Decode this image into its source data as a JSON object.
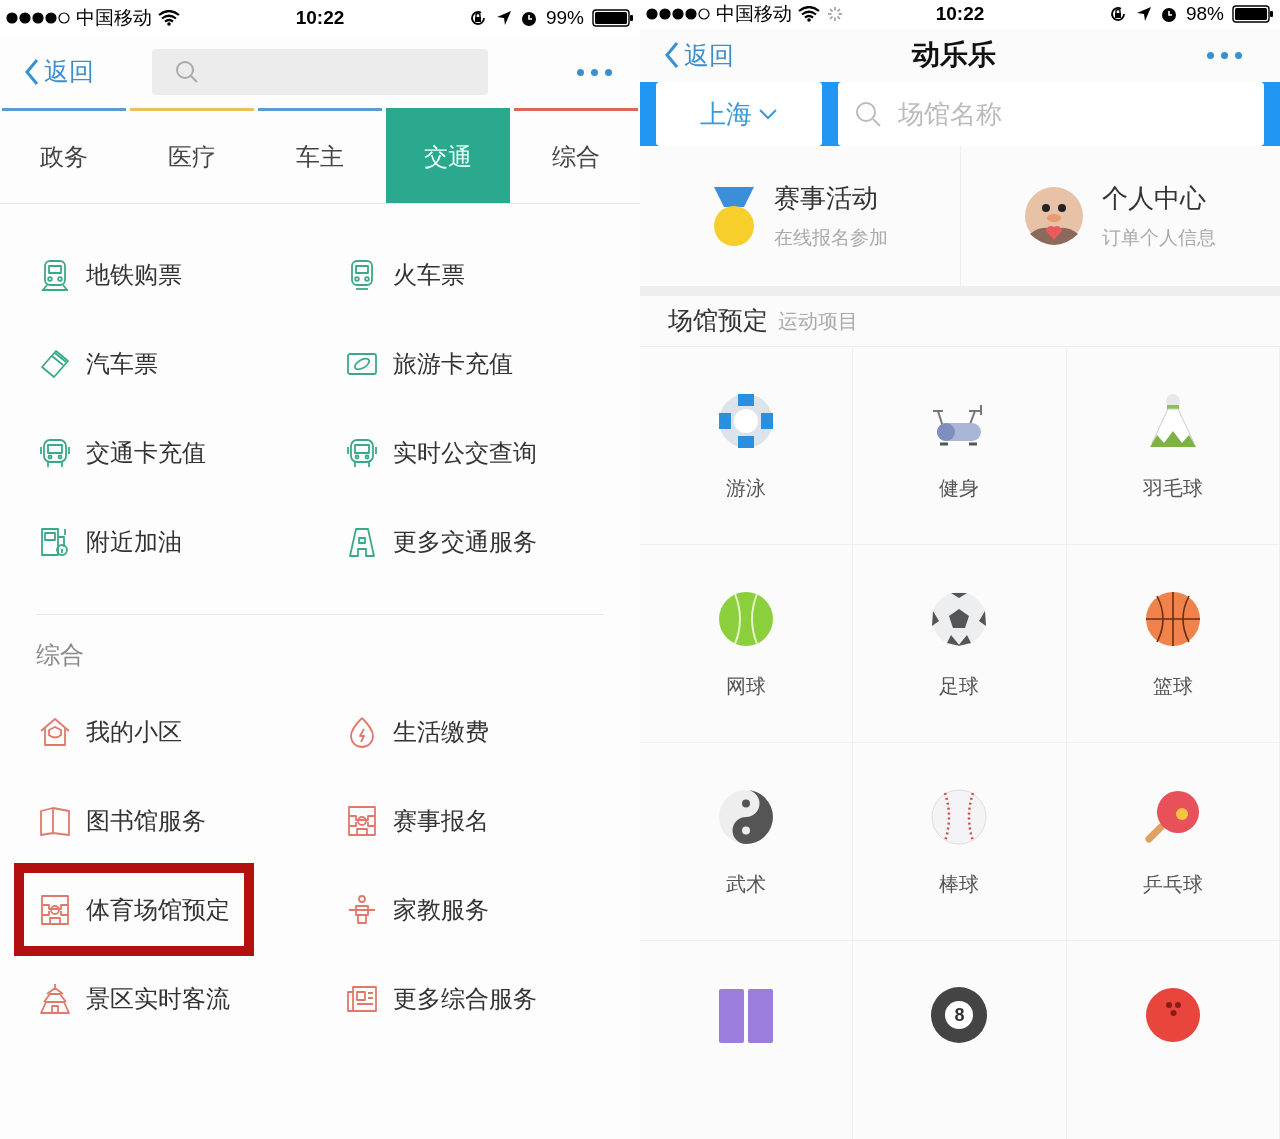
{
  "left": {
    "status_bar": {
      "carrier": "中国移动",
      "time": "10:22",
      "battery": "99%",
      "loading": false
    },
    "nav": {
      "back": "返回"
    },
    "tabs": [
      {
        "label": "政务",
        "selected": false,
        "color": "#5b9bd5"
      },
      {
        "label": "医疗",
        "selected": false,
        "color": "#e8c15e"
      },
      {
        "label": "车主",
        "selected": false,
        "color": "#5b9bd5"
      },
      {
        "label": "交通",
        "selected": true,
        "color": "#2aa98e"
      },
      {
        "label": "综合",
        "selected": false,
        "color": "#d9675c"
      }
    ],
    "sections": [
      {
        "color": "#3aa98a",
        "items": [
          {
            "label": "地铁购票",
            "highlighted": false
          },
          {
            "label": "火车票",
            "highlighted": false
          },
          {
            "label": "汽车票",
            "highlighted": false
          },
          {
            "label": "旅游卡充值",
            "highlighted": false
          },
          {
            "label": "交通卡充值",
            "highlighted": false
          },
          {
            "label": "实时公交查询",
            "highlighted": false
          },
          {
            "label": "附近加油",
            "highlighted": false
          },
          {
            "label": "更多交通服务",
            "highlighted": false
          }
        ]
      },
      {
        "title": "综合",
        "color": "#e0796c",
        "items": [
          {
            "label": "我的小区",
            "highlighted": false
          },
          {
            "label": "生活缴费",
            "highlighted": false
          },
          {
            "label": "图书馆服务",
            "highlighted": false
          },
          {
            "label": "赛事报名",
            "highlighted": false
          },
          {
            "label": "体育场馆预定",
            "highlighted": true
          },
          {
            "label": "家教服务",
            "highlighted": false
          },
          {
            "label": "景区实时客流",
            "highlighted": false
          },
          {
            "label": "更多综合服务",
            "highlighted": false
          }
        ]
      }
    ]
  },
  "right": {
    "status_bar": {
      "carrier": "中国移动",
      "time": "10:22",
      "battery": "98%",
      "loading": true
    },
    "nav": {
      "back": "返回",
      "title": "动乐乐"
    },
    "city": "上海",
    "search": {
      "placeholder": "场馆名称"
    },
    "features": [
      {
        "title": "赛事活动",
        "subtitle": "在线报名参加"
      },
      {
        "title": "个人中心",
        "subtitle": "订单个人信息"
      }
    ],
    "section": {
      "title": "场馆预定",
      "subtitle": "运动项目"
    },
    "sports": [
      {
        "kind": "sport",
        "label": "游泳"
      },
      {
        "kind": "sport",
        "label": "健身"
      },
      {
        "kind": "sport",
        "label": "羽毛球"
      },
      {
        "kind": "sport",
        "label": "网球"
      },
      {
        "kind": "sport",
        "label": "足球"
      },
      {
        "kind": "sport",
        "label": "篮球"
      },
      {
        "kind": "sport",
        "label": "武术"
      },
      {
        "kind": "sport",
        "label": "棒球"
      },
      {
        "kind": "sport",
        "label": "乒乓球"
      },
      {
        "kind": "partial"
      },
      {
        "kind": "partial",
        "number": "8"
      },
      {
        "kind": "partial"
      }
    ]
  }
}
